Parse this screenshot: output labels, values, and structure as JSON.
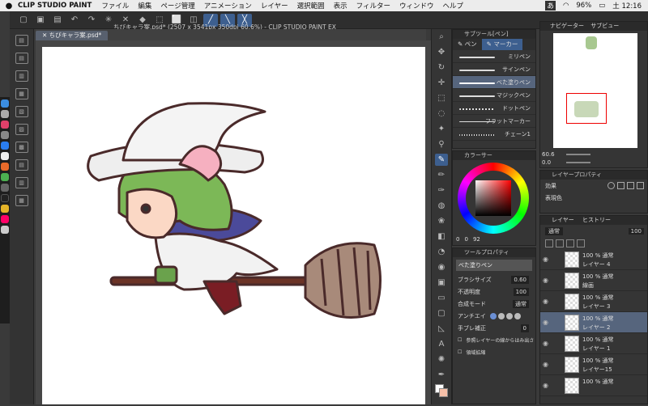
{
  "menubar": {
    "app": "CLIP STUDIO PAINT",
    "items": [
      "ファイル",
      "編集",
      "ページ管理",
      "アニメーション",
      "レイヤー",
      "選択範囲",
      "表示",
      "フィルター",
      "ウィンドウ",
      "ヘルプ"
    ],
    "battery": "96%",
    "time": "土 12:16",
    "input": "あ"
  },
  "window_title": "ちびキャラ案.psd* (2507 x 3541px 350dpi 60.6%) - CLIP STUDIO PAINT EX",
  "doc_tab": "ちびキャラ案.psd*",
  "subtool": {
    "header": "サブツール[ペン]",
    "tabs": [
      "ペン",
      "マーカー"
    ],
    "brushes": [
      "ミリペン",
      "サインペン",
      "べた塗りペン",
      "マジックペン",
      "ドットペン",
      "フラットマーカー",
      "チェーン1"
    ],
    "selected_index": 2
  },
  "color": {
    "header": "カラーサー",
    "values": [
      "0",
      "0",
      "92"
    ]
  },
  "toolprop": {
    "header": "ツールプロパティ",
    "brush_name": "べた塗りペン",
    "size_label": "ブラシサイズ",
    "size_value": "0.60",
    "opacity_label": "不透明度",
    "opacity_value": "100",
    "blend_label": "合成モード",
    "blend_value": "通常",
    "aa_label": "アンチエイ",
    "stab_label": "手ブレ補正",
    "stab_value": "0",
    "ref_label": "参照レイヤーの線からはみ出さ",
    "area_label": "領域拡縮"
  },
  "navigator": {
    "tabs": [
      "ナビゲーター",
      "サブビュー"
    ],
    "zoom": "60.6",
    "rotate": "0.0"
  },
  "layerprop": {
    "header": "レイヤープロパティ",
    "effect_label": "効果",
    "expr_label": "表現色"
  },
  "layers": {
    "tabs": [
      "レイヤー",
      "ヒストリー"
    ],
    "blend": "通常",
    "opacity": "100",
    "items": [
      {
        "pct": "100 % 通常",
        "name": "レイヤー 4"
      },
      {
        "pct": "100 % 通常",
        "name": "線画"
      },
      {
        "pct": "100 % 通常",
        "name": "レイヤー 3"
      },
      {
        "pct": "100 % 通常",
        "name": "レイヤー 2"
      },
      {
        "pct": "100 % 通常",
        "name": "レイヤー 1"
      },
      {
        "pct": "100 % 通常",
        "name": "レイヤー15"
      },
      {
        "pct": "100 % 通常",
        "name": ""
      }
    ],
    "selected_index": 3
  }
}
